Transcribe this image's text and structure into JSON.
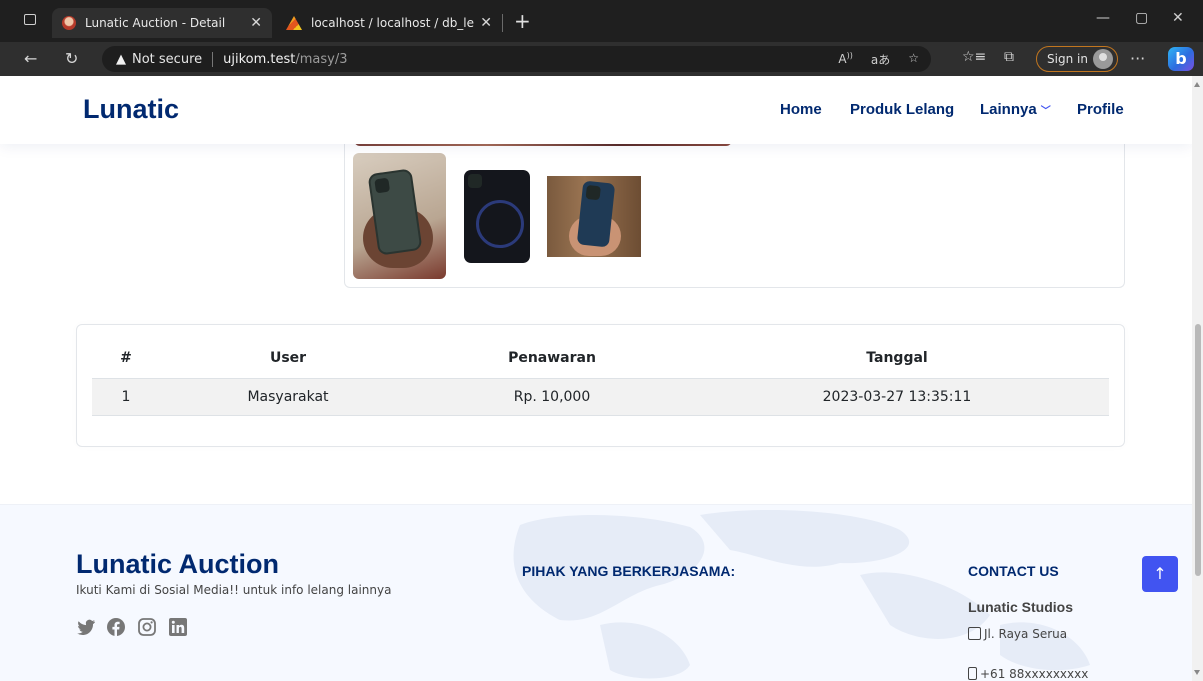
{
  "browser": {
    "tabs": [
      {
        "title": "Lunatic Auction - Detail",
        "active": true
      },
      {
        "title": "localhost / localhost / db_lelang",
        "active": false
      }
    ],
    "security_label": "Not secure",
    "url_host": "ujikom.test",
    "url_path": "/masy/3",
    "sign_in_label": "Sign in",
    "more_label": "···",
    "accent_color": "#c2761f"
  },
  "navbar": {
    "brand": "Lunatic",
    "links": [
      "Home",
      "Produk Lelang",
      "Lainnya",
      "Profile"
    ]
  },
  "bids_table": {
    "headers": [
      "#",
      "User",
      "Penawaran",
      "Tanggal"
    ],
    "rows": [
      {
        "no": "1",
        "user": "Masyarakat",
        "offer": "Rp. 10,000",
        "date": "2023-03-27 13:35:11"
      }
    ]
  },
  "footer": {
    "brand": "Lunatic Auction",
    "tagline": "Ikuti Kami di Sosial Media!! untuk info lelang lainnya",
    "social_icons": [
      "twitter-icon",
      "facebook-icon",
      "instagram-icon",
      "linkedin-icon"
    ],
    "partners_heading": "PIHAK YANG BERKERJASAMA:",
    "contact_heading": "CONTACT US",
    "company": "Lunatic Studios",
    "address": "Jl. Raya Serua",
    "phone": "+61 88xxxxxxxxx"
  },
  "colors": {
    "brand_navy": "#012970",
    "primary_blue": "#4154f1",
    "footer_bg": "#f6f9ff"
  }
}
